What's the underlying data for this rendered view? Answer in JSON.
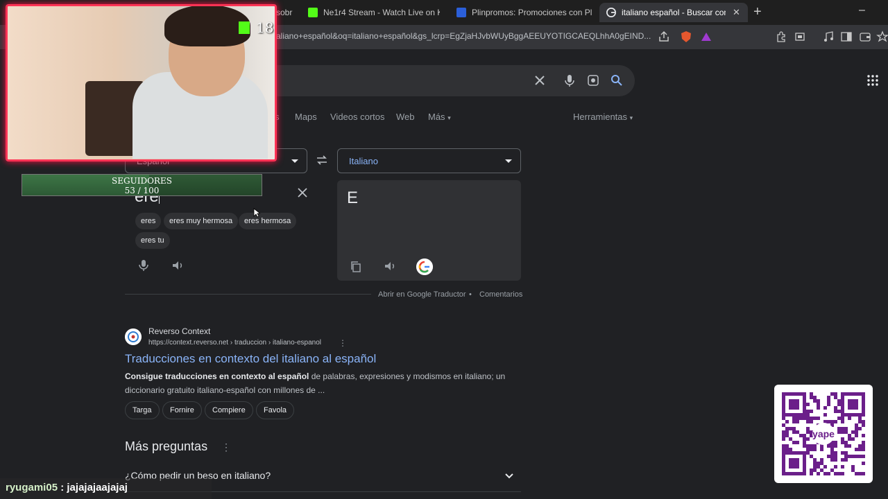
{
  "browser": {
    "tabs": [
      {
        "label": "sobr",
        "favicon_color": "#2b2b2b"
      },
      {
        "label": "Ne1r4 Stream - Watch Live on Kick",
        "favicon_color": "#53fc18"
      },
      {
        "label": "Plinpromos: Promociones con Plin | I",
        "favicon_color": "#2b5fd9"
      },
      {
        "label": "italiano español - Buscar con Go",
        "favicon_color": "#ffffff"
      }
    ],
    "url": "aliano+español&oq=italiano+español&gs_lcrp=EgZjaHJvbWUyBggAEEUYOTIGCAEQLhhA0gEIND..."
  },
  "nav": {
    "tabs": [
      "s",
      "Maps",
      "Videos cortos",
      "Web",
      "Más"
    ],
    "tools": "Herramientas"
  },
  "translator": {
    "source_lang": "Español",
    "target_lang": "Italiano",
    "input_text": "ere",
    "output_text": "E",
    "suggestions": [
      "eres",
      "eres muy hermosa",
      "eres hermosa",
      "eres tu"
    ],
    "open_link": "Abrir en Google Traductor",
    "separator": "•",
    "feedback": "Comentarios"
  },
  "result": {
    "site_name": "Reverso Context",
    "site_url": "https://context.reverso.net › traduccion › italiano-espanol",
    "title": "Traducciones en contexto del italiano al español",
    "snippet_bold": "Consigue traducciones en contexto al español",
    "snippet_rest": " de palabras, expresiones y modismos en italiano; un diccionario gratuito italiano-español con millones de ...",
    "chips": [
      "Targa",
      "Fornire",
      "Compiere",
      "Favola"
    ]
  },
  "paa": {
    "title": "Más preguntas",
    "question": "¿Cómo pedir un beso en italiano?"
  },
  "overlay": {
    "kick_count": "18",
    "followers_label": "SEGUIDORES",
    "followers_count": "53 / 100",
    "followers_fraction": 0.53,
    "chat_user": "ryugami05",
    "chat_sep": " : ",
    "chat_message": "jajajajaajajaj",
    "qr_brand": "yape"
  },
  "colors": {
    "accent_link": "#8ab4f8",
    "overlay_border": "#ff3355",
    "kick_green": "#53fc18",
    "yape_purple": "#6b1f8a"
  }
}
